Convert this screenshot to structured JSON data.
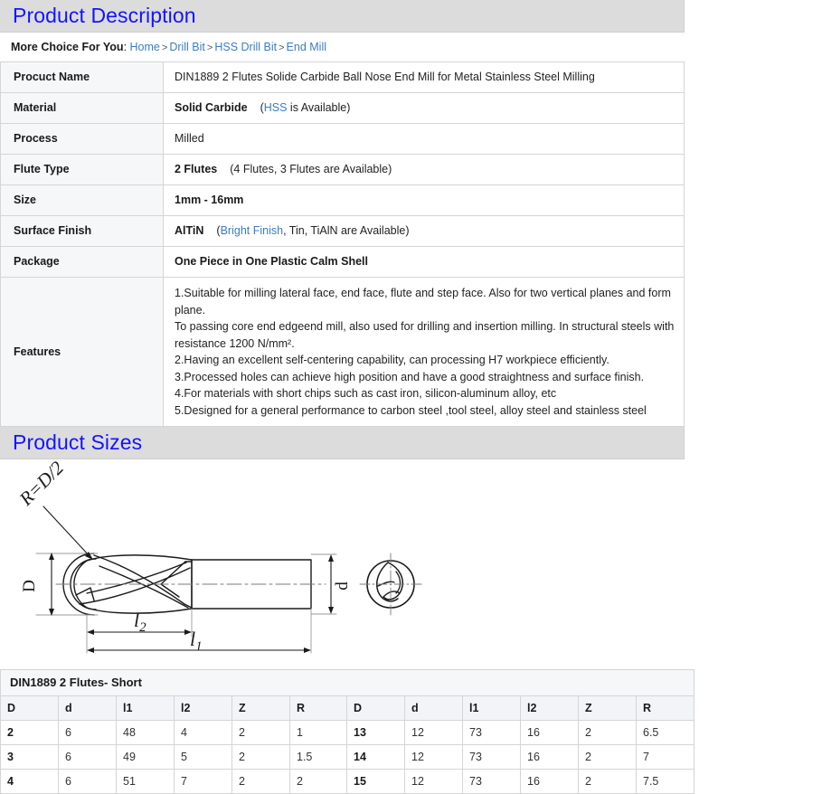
{
  "sections": {
    "description_title": "Product Description",
    "sizes_title": "Product Sizes"
  },
  "breadcrumb": {
    "label": "More Choice For You",
    "colon": ":",
    "separator": ">",
    "links": [
      "Home",
      "Drill Bit",
      "HSS Drill Bit",
      "End Mill"
    ]
  },
  "spec": {
    "rows": [
      {
        "key": "Procuct Name",
        "value": "DIN1889 2 Flutes Solide Carbide Ball Nose End Mill for Metal Stainless Steel Milling",
        "bold": false
      },
      {
        "key": "Material",
        "value": "Solid Carbide",
        "bold": true,
        "note_accent": "HSS",
        "note_rest": " is Available)",
        "note_open": "("
      },
      {
        "key": "Process",
        "value": "Milled",
        "bold": false
      },
      {
        "key": "Flute Type",
        "value": "2 Flutes",
        "bold": true,
        "note_plain": "(4 Flutes, 3 Flutes are Available)"
      },
      {
        "key": "Size",
        "value": "1mm - 16mm",
        "bold": true
      },
      {
        "key": "Surface Finish",
        "value": "AlTiN",
        "bold": true,
        "note_accent": "Bright Finish",
        "note_rest": ", Tin, TiAlN are Available)",
        "note_open": "("
      },
      {
        "key": "Package",
        "value": "One Piece in One Plastic Calm Shell",
        "bold": true
      }
    ],
    "features_key": "Features",
    "features": [
      "1.Suitable for milling lateral face, end face, flute and step face. Also for two vertical planes and form plane.",
      "To passing core end edgeend mill, also used for drilling and insertion milling. In structural steels with",
      "resistance 1200 N/mm².",
      "2.Having an excellent self-centering capability, can processing H7 workpiece efficiently.",
      "3.Processed holes can achieve high position and have a good straightness and surface finish.",
      "4.For materials with short chips such as cast iron, silicon-aluminum alloy, etc",
      "5.Designed for a general performance to carbon steel ,tool steel, alloy steel and stainless steel"
    ]
  },
  "drawing": {
    "labels": {
      "radius": "R=D/2",
      "diameter": "D",
      "shank": "d",
      "flute_length": "l",
      "flute_length_sub": "2",
      "total_length": "l",
      "total_length_sub": "1"
    }
  },
  "dim_table": {
    "caption": "DIN1889 2 Flutes- Short",
    "headers": [
      "D",
      "d",
      "l1",
      "l2",
      "Z",
      "R",
      "D",
      "d",
      "l1",
      "l2",
      "Z",
      "R"
    ],
    "rows": [
      [
        "2",
        "6",
        "48",
        "4",
        "2",
        "1",
        "13",
        "12",
        "73",
        "16",
        "2",
        "6.5"
      ],
      [
        "3",
        "6",
        "49",
        "5",
        "2",
        "1.5",
        "14",
        "12",
        "73",
        "16",
        "2",
        "7"
      ],
      [
        "4",
        "6",
        "51",
        "7",
        "2",
        "2",
        "15",
        "12",
        "73",
        "16",
        "2",
        "7.5"
      ]
    ]
  },
  "colors": {
    "heading_blue": "#1414ff",
    "link_blue": "#3a7dc4",
    "banner_gray": "#dcdcdc",
    "cell_gray": "#f6f7f9",
    "border": "#d5d5d5"
  }
}
